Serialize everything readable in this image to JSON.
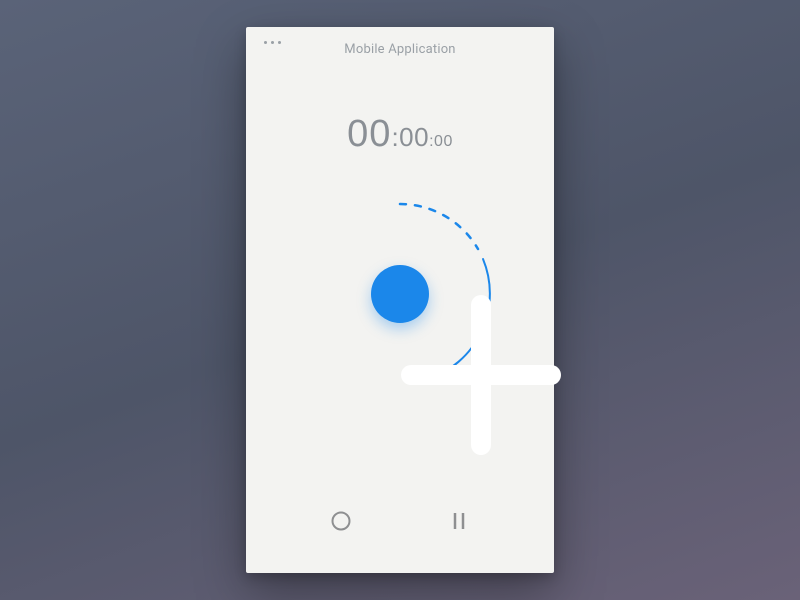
{
  "header": {
    "title": "Mobile Application"
  },
  "timer": {
    "hours": "00",
    "minutes": "00",
    "seconds": "00"
  },
  "dial": {
    "accent_color": "#1b87ea"
  },
  "buttons": {
    "add_icon": "plus-icon",
    "record_icon": "circle-icon",
    "pause_icon": "pause-icon"
  }
}
